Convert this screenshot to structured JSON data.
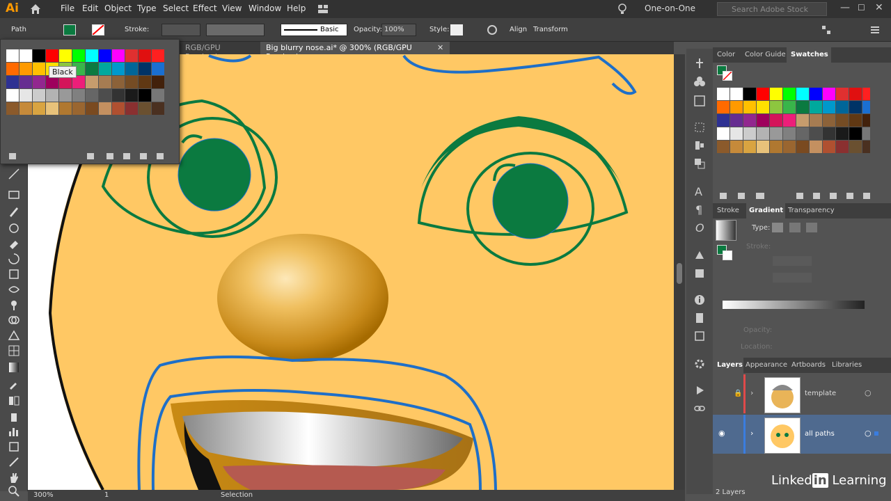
{
  "app": {
    "logo": "Ai"
  },
  "menubar": {
    "items": [
      "File",
      "Edit",
      "Object",
      "Type",
      "Select",
      "Effect",
      "View",
      "Window",
      "Help"
    ],
    "workspace": "One-on-One",
    "search_placeholder": "Search Adobe Stock"
  },
  "controlbar": {
    "selection_type": "Path",
    "stroke_label": "Stroke:",
    "brush": "Basic",
    "opacity_label": "Opacity:",
    "opacity_value": "100%",
    "style_label": "Style:",
    "align": "Align",
    "transform": "Transform"
  },
  "tabs": [
    {
      "label": "RGB/GPU Preview)"
    },
    {
      "label": "Big blurry nose.ai* @ 300% (RGB/GPU Preview)"
    }
  ],
  "swatch_popup": {
    "tooltip": "Black"
  },
  "status": {
    "zoom": "300%",
    "page": "1",
    "tool": "Selection"
  },
  "right_panel": {
    "top_tabs": [
      "Color",
      "Color Guide",
      "Swatches"
    ],
    "mid_tabs": [
      "Stroke",
      "Gradient",
      "Transparency"
    ],
    "gradient": {
      "type_label": "Type:",
      "stroke_label": "Stroke:",
      "opacity_label": "Opacity:",
      "location_label": "Location:"
    },
    "bottom_tabs": [
      "Layers",
      "Appearance",
      "Artboards",
      "Libraries"
    ],
    "layers": [
      {
        "name": "template"
      },
      {
        "name": "all paths"
      }
    ],
    "layers_count": "2 Layers"
  },
  "watermark": {
    "brand": "Linked",
    "in": "in",
    "suffix": "Learning"
  },
  "colors": {
    "face": "#ffc864",
    "green": "#0b7a40",
    "blue_path": "#1e6fc8",
    "nose": "#c88a1a"
  }
}
